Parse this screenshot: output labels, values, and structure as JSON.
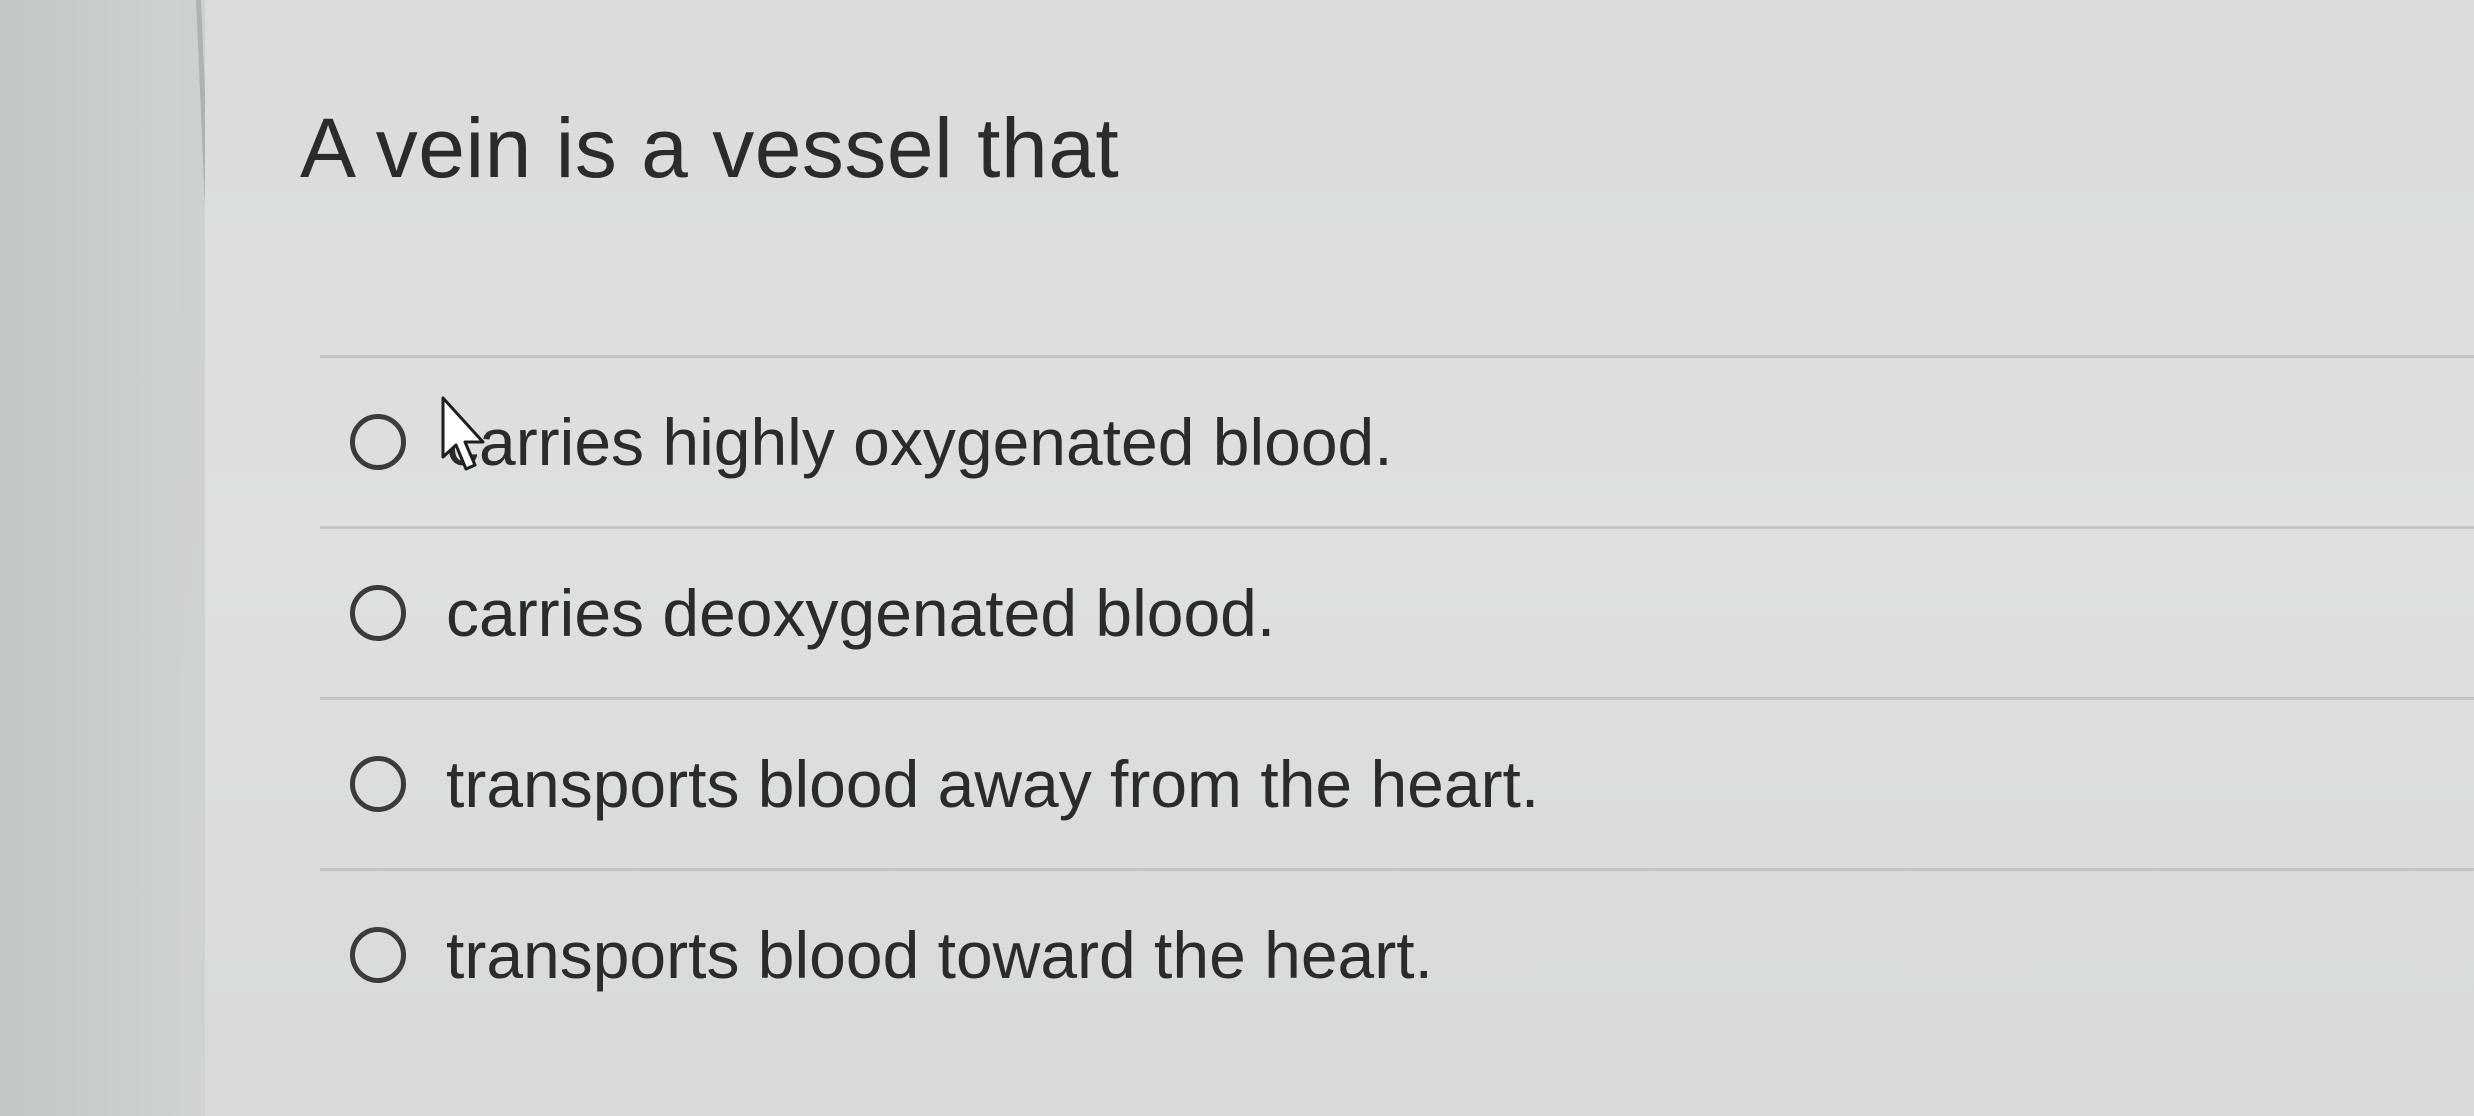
{
  "question": {
    "text": "A vein is a vessel that"
  },
  "options": [
    {
      "label": "carries highly oxygenated blood.",
      "selected": false
    },
    {
      "label": "carries deoxygenated blood.",
      "selected": false
    },
    {
      "label": "transports blood away from the heart.",
      "selected": false
    },
    {
      "label": "transports blood toward the heart.",
      "selected": false
    }
  ],
  "cursor": {
    "icon": "arrow-pointer-icon"
  }
}
